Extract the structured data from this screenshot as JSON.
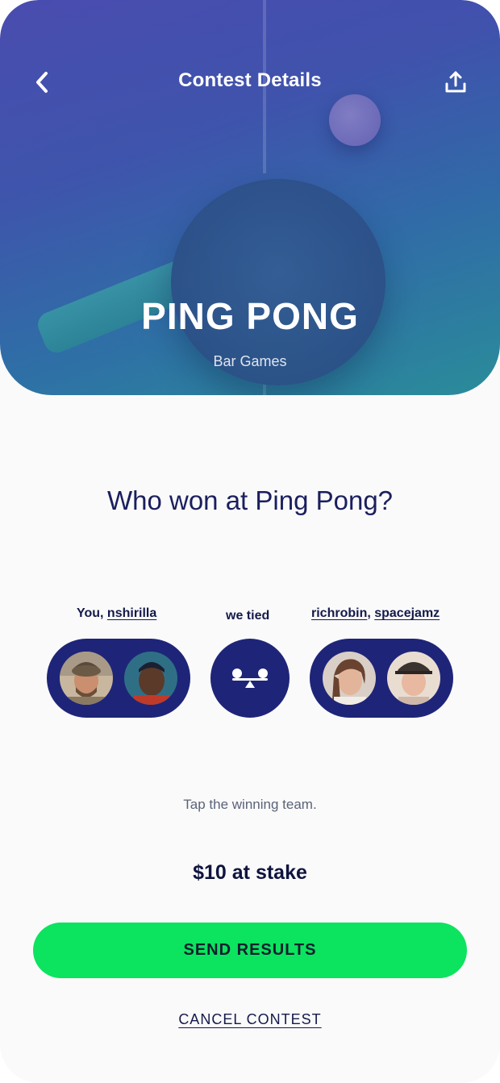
{
  "header": {
    "title": "Contest Details",
    "back_icon": "chevron-left-icon",
    "share_icon": "share-upload-icon"
  },
  "contest": {
    "game": "PING PONG",
    "category": "Bar Games"
  },
  "question": "Who won at Ping Pong?",
  "teams": {
    "left": {
      "prefix": "You, ",
      "member": "nshirilla"
    },
    "tie": {
      "label": "we tied",
      "icon": "balance-scale-icon"
    },
    "right": {
      "member1": "richrobin",
      "separator": ", ",
      "member2": "spacejamz"
    }
  },
  "hint": "Tap the winning team.",
  "stake": "$10 at stake",
  "actions": {
    "send": "SEND RESULTS",
    "cancel": "CANCEL CONTEST"
  },
  "colors": {
    "accent_navy": "#1e2578",
    "primary_green": "#0ce35f",
    "text_dark": "#0f143f",
    "hint_gray": "#5a6378"
  }
}
